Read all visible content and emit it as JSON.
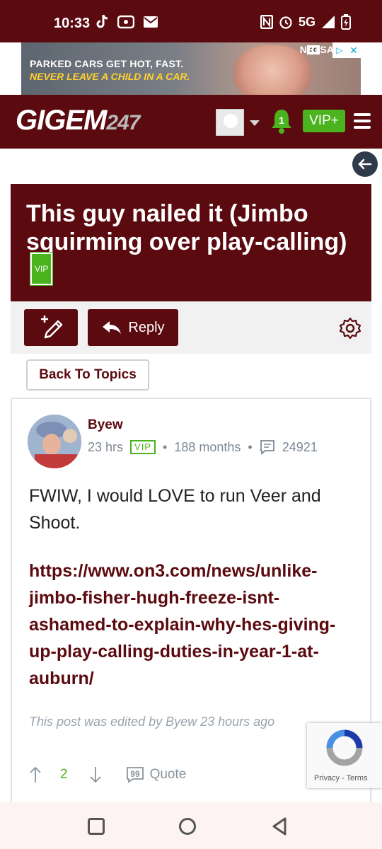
{
  "status_bar": {
    "time": "10:33",
    "network": "5G",
    "left_icons": [
      "tiktok-icon",
      "radio-icon",
      "mail-icon"
    ],
    "right_icons": [
      "nfc-icon",
      "alarm-icon",
      "signal-icon",
      "battery-icon"
    ]
  },
  "ad": {
    "line1": "PARKED CARS GET HOT, FAST.",
    "line2": "NEVER LEAVE A CHILD IN A CAR.",
    "ad_badge": "ad",
    "advertiser": "NHTSA"
  },
  "header": {
    "logo_text": "GIGEM",
    "logo_number": "247",
    "notification_count": "1",
    "vip_label": "VIP+"
  },
  "thread": {
    "title": "This guy nailed it (Jimbo squirming over play-calling)",
    "title_badge": "VIP"
  },
  "actions": {
    "reply_label": "Reply",
    "back_to_topics_label": "Back To Topics"
  },
  "post": {
    "username": "Byew",
    "time_ago": "23 hrs",
    "badge": "VIP",
    "membership": "188 months",
    "post_count": "24921",
    "body": "FWIW, I would LOVE to run Veer and Shoot.",
    "link": "https://www.on3.com/news/unlike-jimbo-fisher-hugh-freeze-isnt-ashamed-to-explain-why-hes-giving-up-play-calling-duties-in-year-1-at-auburn/",
    "edited_note": "This post was edited by Byew 23 hours ago",
    "upvotes": "2",
    "quote_label": "Quote"
  },
  "recaptcha": {
    "label": "Privacy - Terms"
  },
  "colors": {
    "brand_maroon": "#5b0a0f",
    "vip_green": "#4ab31e",
    "meta_gray": "#7d8893"
  }
}
